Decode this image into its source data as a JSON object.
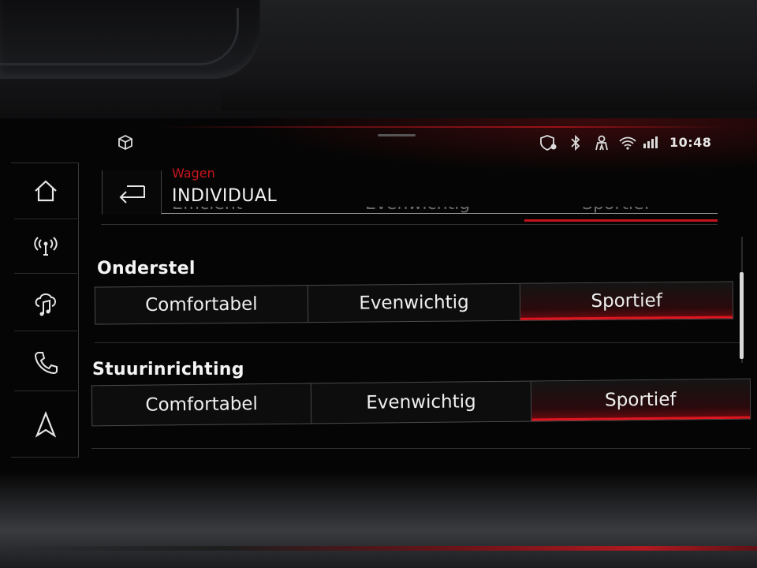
{
  "status": {
    "time": "10:48",
    "icons": [
      "package-icon",
      "location-shield-icon",
      "bluetooth-icon",
      "driver-icon",
      "wifi-icon",
      "lte-signal-icon"
    ]
  },
  "nav": {
    "items": [
      "home-icon",
      "car-signal-icon",
      "music-icon",
      "phone-icon",
      "navigation-arrow-icon"
    ]
  },
  "header": {
    "subtitle": "Wagen",
    "title": "INDIVIDUAL"
  },
  "ghost_row": {
    "options": [
      "Efficiënt",
      "Evenwichtig",
      "Sportief"
    ],
    "selected": "Sportief"
  },
  "sections": [
    {
      "label": "Onderstel",
      "options": [
        "Comfortabel",
        "Evenwichtig",
        "Sportief"
      ],
      "selected": "Sportief"
    },
    {
      "label": "Stuurinrichting",
      "options": [
        "Comfortabel",
        "Evenwichtig",
        "Sportief"
      ],
      "selected": "Sportief"
    }
  ],
  "colors": {
    "accent_red": "#e0151f",
    "subtitle_red": "#c8151d",
    "text": "#f2f2f2"
  }
}
